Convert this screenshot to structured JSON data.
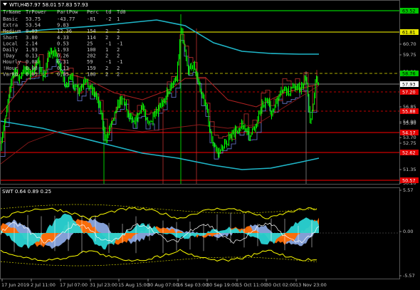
{
  "window": {
    "title": "WTI,H4",
    "ohlc": "57.97 58.01 57.83 57.93",
    "icon": "triangle-down-icon"
  },
  "table": {
    "headers": [
      "TrName",
      "TrPower",
      "PartPow",
      "Perc",
      "td",
      "Td0"
    ],
    "rows": [
      [
        "Basic",
        "53.75",
        "-43.77",
        "-81",
        "-2",
        "1"
      ],
      [
        "Extra",
        "53.54",
        "9.83",
        "",
        "",
        ""
      ],
      [
        "Medium",
        "8.03",
        "12.36",
        "154",
        "2",
        "2"
      ],
      [
        "Short",
        "3.80",
        "4.33",
        "114",
        "2",
        "2"
      ],
      [
        "Local",
        "2.14",
        "0.53",
        "25",
        "-1",
        "-1"
      ],
      [
        "Daily",
        "1.93",
        "1.93",
        "100",
        "1",
        "2"
      ],
      [
        "!Day",
        "0.13",
        "0.26",
        "202",
        "2",
        "2"
      ],
      [
        "Hourly",
        "0.08",
        "0.31",
        "59",
        "-1",
        "-1"
      ],
      [
        "!Hour",
        "0.08",
        "0.13",
        "159",
        "2",
        "2"
      ],
      [
        "VarR0",
        "0.05",
        "0.05",
        "100",
        "2",
        "2"
      ]
    ]
  },
  "price_axis": {
    "ticks": [
      "60.70",
      "59.75",
      "58.80",
      "56.85",
      "55.90",
      "54.90",
      "53.70",
      "52.75",
      "51.35",
      "50.20"
    ],
    "tags": [
      {
        "label": "63.52",
        "kind": "green"
      },
      {
        "label": "61.81",
        "kind": "yellow"
      },
      {
        "label": "58.76",
        "kind": "green"
      },
      {
        "label": "57.93",
        "kind": "white"
      },
      {
        "label": "57.20",
        "kind": "red"
      },
      {
        "label": "55.88",
        "kind": "red"
      },
      {
        "label": "54.17",
        "kind": "red"
      },
      {
        "label": "52.62",
        "kind": "red"
      },
      {
        "label": "50.57",
        "kind": "red"
      }
    ]
  },
  "oscillator": {
    "title": "SWT 0.64 0.89 0.25",
    "ticks": [
      "5.57",
      "0.00",
      "-5.57"
    ]
  },
  "time_axis": {
    "labels": [
      "17 Jun 2019",
      "2 Jul 11:00",
      "17 Jul 07:00",
      "31 Jul 23:00",
      "15 Aug 15:00",
      "30 Aug 07:00",
      "16 Sep 03:00",
      "30 Sep 19:00",
      "15 Oct 11:00",
      "30 Oct 02:00",
      "13 Nov 23:00"
    ]
  },
  "colors": {
    "background": "#000000",
    "price": "#00ff00",
    "level_yellow": "#ffff00",
    "level_red": "#ff0000",
    "channel_cyan": "#1fb6c8",
    "ma_red": "#b22222",
    "steps_blue": "#6c7fd8",
    "osc_orange": "#ff6a00",
    "osc_cyan": "#2ad4d4",
    "osc_blue": "#8aa7e0"
  }
}
